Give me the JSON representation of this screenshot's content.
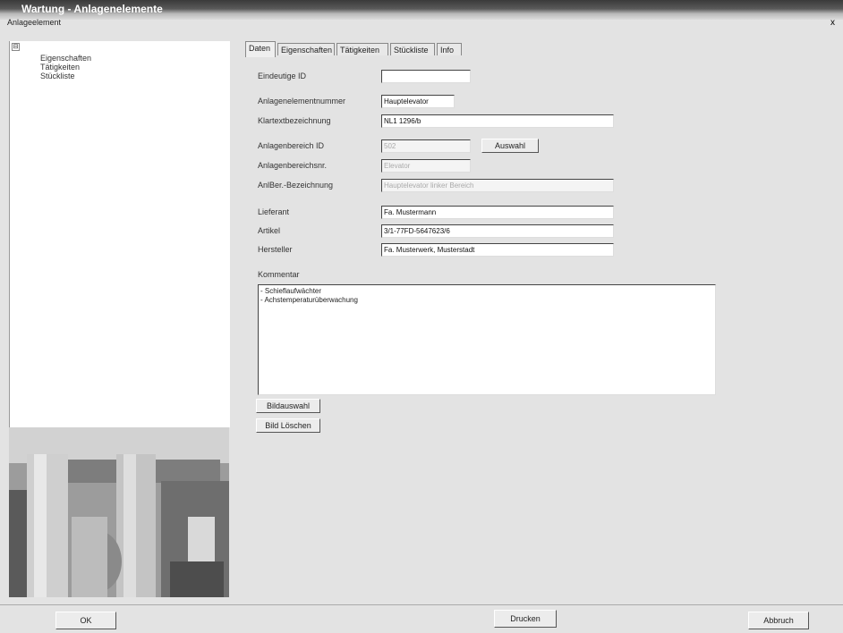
{
  "window": {
    "title": "Wartung - Anlagenelemente",
    "close_label": "x"
  },
  "menu": {
    "label": "Anlageelement"
  },
  "tree": {
    "expander": "⊟",
    "items": [
      {
        "label": "Eigenschaften"
      },
      {
        "label": "Tätigkeiten"
      },
      {
        "label": "Stückliste"
      }
    ]
  },
  "tabs": [
    {
      "label": "Daten"
    },
    {
      "label": "Eigenschaften"
    },
    {
      "label": "Tätigkeiten"
    },
    {
      "label": "Stückliste"
    },
    {
      "label": "Info"
    }
  ],
  "form": {
    "eindeutige_id": {
      "label": "Eindeutige ID",
      "value": ""
    },
    "anlagenelementnummer": {
      "label": "Anlagenelementnummer",
      "value": "Hauptelevator"
    },
    "klartextbezeichnung": {
      "label": "Klartextbezeichnung",
      "value": "NL1 1296/b"
    },
    "anlagenbereich_id": {
      "label": "Anlagenbereich ID",
      "value": "502"
    },
    "auswahl_button": "Auswahl",
    "anlagenbereichsnr": {
      "label": "Anlagenbereichsnr.",
      "value": "Elevator"
    },
    "anlber_bezeichnung": {
      "label": "AnlBer.-Bezeichnung",
      "value": "Hauptelevator linker Bereich"
    },
    "lieferant": {
      "label": "Lieferant",
      "value": "Fa. Mustermann"
    },
    "artikel": {
      "label": "Artikel",
      "value": "3/1-77FD-5647623/6"
    },
    "hersteller": {
      "label": "Hersteller",
      "value": "Fa. Musterwerk, Musterstadt"
    },
    "kommentar": {
      "label": "Kommentar",
      "lines": [
        "- Schieflaufwächter",
        "- Achstemperaturüberwachung"
      ]
    },
    "bildauswahl_button": "Bildauswahl",
    "bild_loeschen_button": "Bild Löschen"
  },
  "footer": {
    "ok_button": "OK",
    "drucken_button": "Drucken",
    "abbruch_button": "Abbruch"
  }
}
